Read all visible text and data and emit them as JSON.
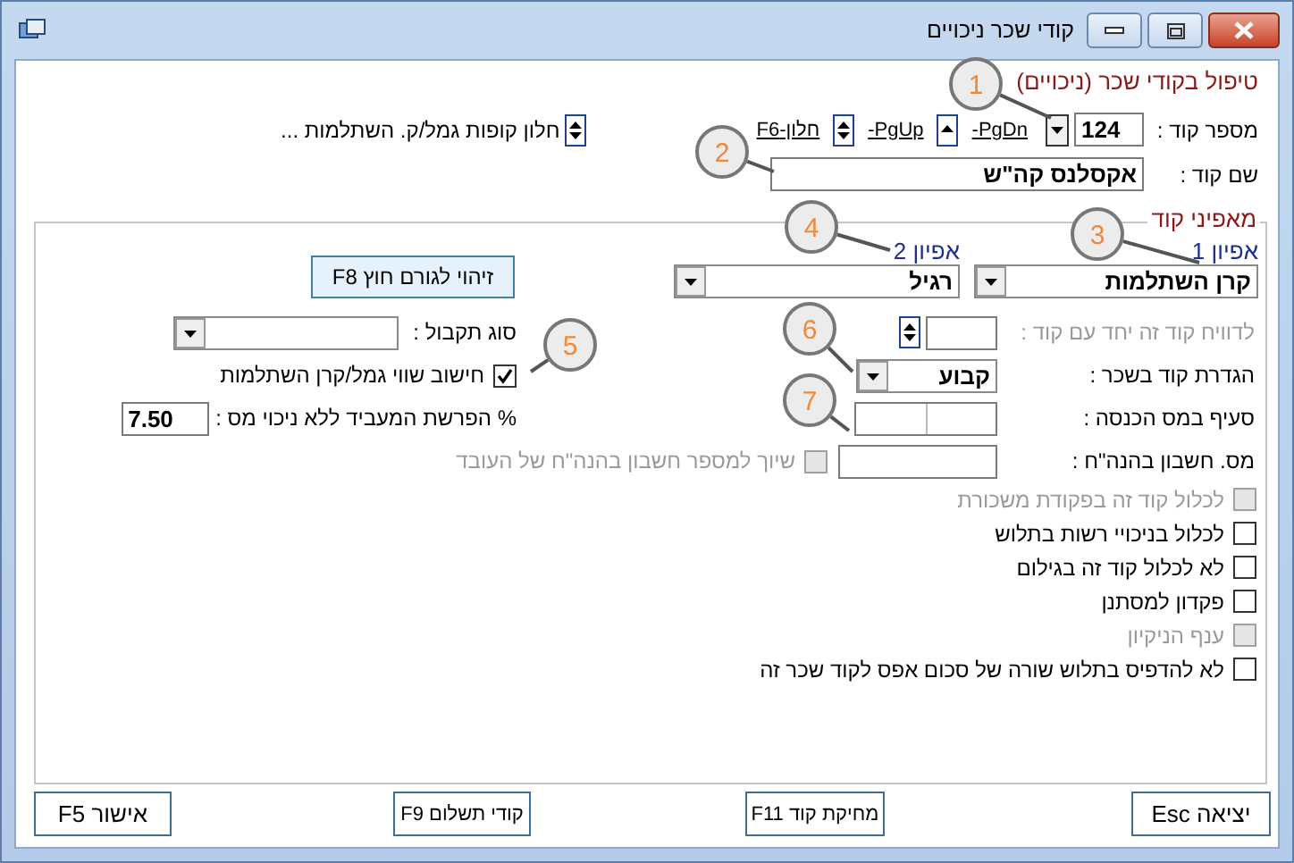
{
  "window": {
    "title": "קודי שכר ניכויים"
  },
  "heading": "טיפול בקודי שכר (ניכויים)",
  "code_number": {
    "label": "מספר קוד :",
    "value": "124"
  },
  "nav_links": [
    {
      "label": "PgDn-",
      "kind": "down"
    },
    {
      "label": "PgUp-",
      "kind": "up"
    },
    {
      "label": "חלון-F6",
      "kind": "updown"
    }
  ],
  "funds_window_link": "חלון קופות גמל/ק. השתלמות ...",
  "code_name": {
    "label": "שם קוד :",
    "value": "אקסלנס קה\"ש"
  },
  "characteristics": {
    "title": "מאפיני קוד",
    "types": [
      {
        "label": "אפיון 1",
        "value": "קרן השתלמות"
      },
      {
        "label": "אפיון 2",
        "value": "רגיל"
      }
    ],
    "external_button": "זיהוי לגורם חוץ F8",
    "report_with_code": {
      "label": "לדוויח קוד זה יחד עם קוד :",
      "disabled": true
    },
    "receipt_type": {
      "label": "סוג תקבול :"
    },
    "salary_definition": {
      "label": "הגדרת קוד בשכר :",
      "value": "קבוע"
    },
    "fund_calc": {
      "label": "חישוב שווי גמל/קרן השתלמות",
      "checked": true
    },
    "tax_section": {
      "label": "סעיף במס הכנסה :"
    },
    "employer_rate": {
      "label": "% הפרשת המעביד ללא ניכוי מס :",
      "value": "7.50"
    },
    "account_number": {
      "label": "מס. חשבון בהנה\"ח :"
    },
    "account_link": {
      "label": "שיוך למספר חשבון בהנה\"ח של העובד",
      "checked": false,
      "disabled": true
    },
    "options": [
      {
        "label": "לכלול קוד זה בפקודת משכורת",
        "checked": false,
        "disabled": true
      },
      {
        "label": "לכלול בניכויי רשות בתלוש",
        "checked": false,
        "disabled": false
      },
      {
        "label": "לא לכלול קוד זה בגילום",
        "checked": false,
        "disabled": false
      },
      {
        "label": "פקדון למסתנן",
        "checked": false,
        "disabled": false
      },
      {
        "label": "ענף הניקיון",
        "checked": false,
        "disabled": true
      },
      {
        "label": "לא להדפיס בתלוש שורה של סכום אפס לקוד שכר זה",
        "checked": false,
        "disabled": false
      }
    ]
  },
  "buttons": [
    {
      "label": "יציאה Esc"
    },
    {
      "label": "מחיקת קוד F11"
    },
    {
      "label": "קודי תשלום F9"
    },
    {
      "label": "אישור F5"
    }
  ],
  "callouts": [
    "1",
    "2",
    "3",
    "4",
    "5",
    "6",
    "7"
  ]
}
